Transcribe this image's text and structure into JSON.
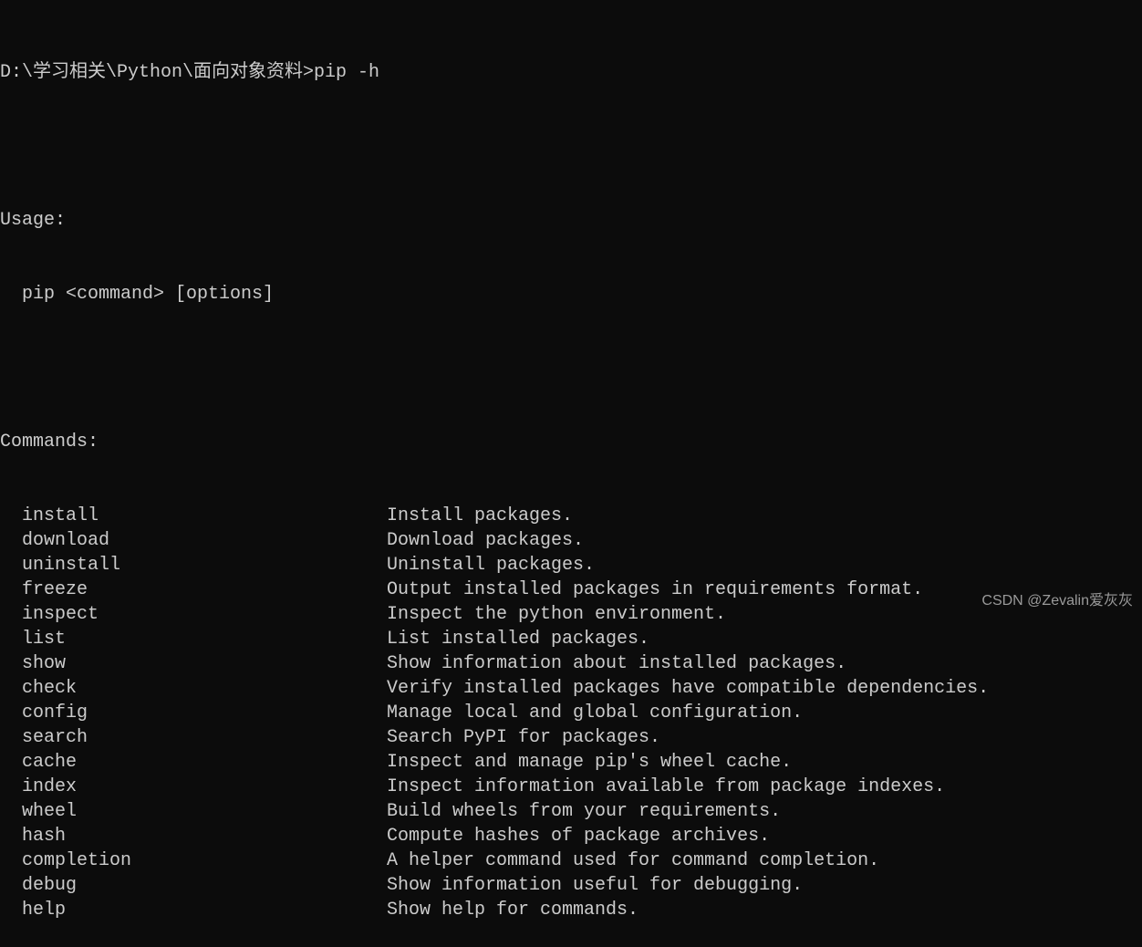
{
  "prompt": {
    "path": "D:\\学习相关\\Python\\面向对象资料>",
    "command": "pip -h"
  },
  "usage": {
    "header": "Usage:",
    "line": "  pip <command> [options]"
  },
  "commands_header": "Commands:",
  "commands": [
    {
      "name": "install",
      "desc": "Install packages."
    },
    {
      "name": "download",
      "desc": "Download packages."
    },
    {
      "name": "uninstall",
      "desc": "Uninstall packages."
    },
    {
      "name": "freeze",
      "desc": "Output installed packages in requirements format."
    },
    {
      "name": "inspect",
      "desc": "Inspect the python environment."
    },
    {
      "name": "list",
      "desc": "List installed packages."
    },
    {
      "name": "show",
      "desc": "Show information about installed packages."
    },
    {
      "name": "check",
      "desc": "Verify installed packages have compatible dependencies."
    },
    {
      "name": "config",
      "desc": "Manage local and global configuration."
    },
    {
      "name": "search",
      "desc": "Search PyPI for packages."
    },
    {
      "name": "cache",
      "desc": "Inspect and manage pip's wheel cache."
    },
    {
      "name": "index",
      "desc": "Inspect information available from package indexes."
    },
    {
      "name": "wheel",
      "desc": "Build wheels from your requirements."
    },
    {
      "name": "hash",
      "desc": "Compute hashes of package archives."
    },
    {
      "name": "completion",
      "desc": "A helper command used for command completion."
    },
    {
      "name": "debug",
      "desc": "Show information useful for debugging."
    },
    {
      "name": "help",
      "desc": "Show help for commands."
    }
  ],
  "watermark": "CSDN @Zevalin爱灰灰"
}
